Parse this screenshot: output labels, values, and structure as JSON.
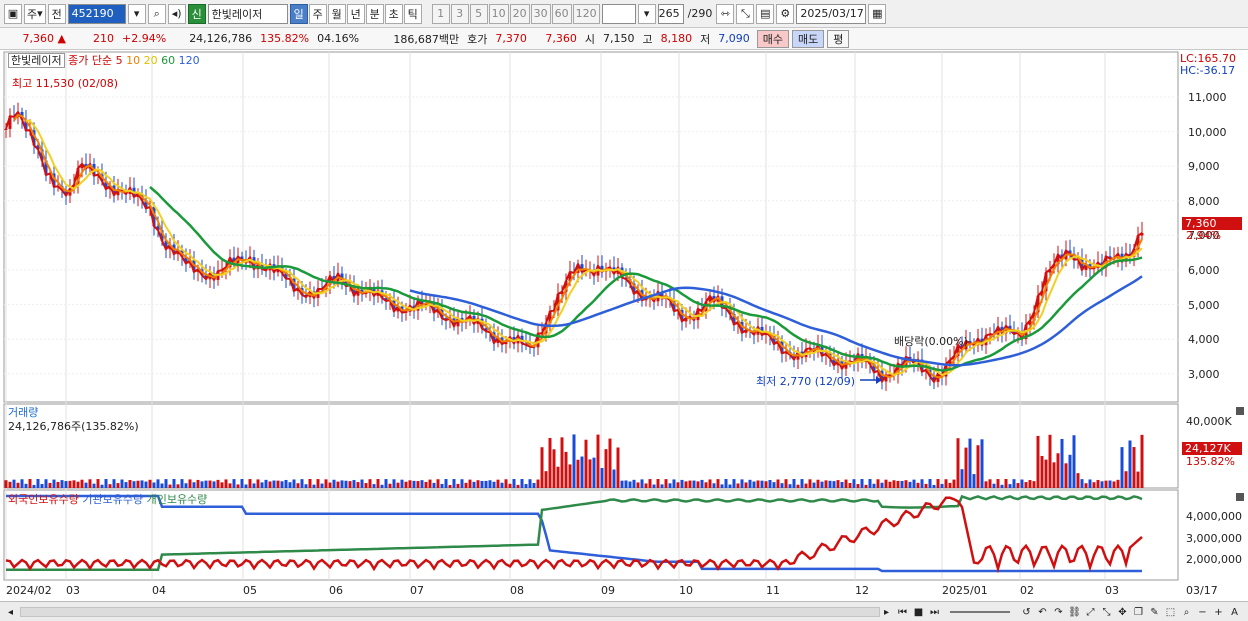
{
  "toolbar": {
    "market_type": "주",
    "market_prefix": "전",
    "stock_code": "452190",
    "new_badge": "신",
    "stock_name": "한빛레이저",
    "periods": [
      "일",
      "주",
      "월",
      "년",
      "분",
      "초",
      "틱"
    ],
    "active_period": "일",
    "interval_buttons": [
      "1",
      "3",
      "5",
      "10",
      "20",
      "30",
      "60",
      "120"
    ],
    "page_counter": "265",
    "page_total": "/290",
    "date": "2025/03/17"
  },
  "quote": {
    "price": "7,360 ▲",
    "change": "210",
    "change_pct": "+2.94%",
    "volume": "24,126,786",
    "volume_ratio": "135.82%",
    "turnover": "04.16%",
    "amount": "186,687백만",
    "bid_label": "호가",
    "bid1": "7,370",
    "bid2": "7,360",
    "open_label": "시",
    "open": "7,150",
    "high_label": "고",
    "high": "8,180",
    "low_label": "저",
    "low": "7,090",
    "buy_button": "매수",
    "sell_button": "매도",
    "eval_button": "평"
  },
  "price_panel": {
    "stock_name_label": "한빛레이저",
    "legend_title": "종가 단순",
    "ma_periods": [
      "5",
      "10",
      "20",
      "60",
      "120"
    ],
    "ma_colors": [
      "#d01010",
      "#f08000",
      "#f0d020",
      "#1a9a3a",
      "#2e5fd8"
    ],
    "high_note": "최고 11,530 (02/08)",
    "low_note": "최저 2,770 (12/09)",
    "dividend_note": "배당락(0.00%)",
    "lc_label": "LC:165.70",
    "hc_label": "HC:-36.17",
    "price_ticks": [
      "11,000",
      "10,000",
      "9,000",
      "8,000",
      "7,000",
      "6,000",
      "5,000",
      "4,000",
      "3,000"
    ],
    "current_price_tag": "7,360",
    "current_pct_tag": "2.94%"
  },
  "volume_panel": {
    "title": "거래량",
    "value_label": "24,126,786주(135.82%)",
    "tick": "40,000K",
    "current_tag": "24,127K",
    "current_pct": "135.82%"
  },
  "holding_panel": {
    "legend": [
      "외국인보유수량",
      "기관보유수량",
      "개인보유수량"
    ],
    "legend_colors": [
      "#d01010",
      "#2e5fd8",
      "#2f8a4a"
    ],
    "ticks": [
      "4,000,000",
      "3,000,000",
      "2,000,000"
    ]
  },
  "x_axis": {
    "labels": [
      "2024/02",
      "03",
      "04",
      "05",
      "06",
      "07",
      "08",
      "09",
      "10",
      "11",
      "12",
      "2025/01",
      "02",
      "03"
    ],
    "right_label": "03/17"
  },
  "chart_data": {
    "type": "candlestick",
    "title": "한빛레이저",
    "x_range": [
      "2024/02",
      "2025/03/17"
    ],
    "y_range": [
      2770,
      11530
    ],
    "close_series_approx": [
      {
        "month": "2024/02",
        "close": 10200
      },
      {
        "month": "2024/03",
        "close": 8700
      },
      {
        "month": "2024/04",
        "close": 7100
      },
      {
        "month": "2024/05",
        "close": 6200
      },
      {
        "month": "2024/06",
        "close": 5600
      },
      {
        "month": "2024/07",
        "close": 4800
      },
      {
        "month": "2024/08",
        "close": 4200
      },
      {
        "month": "2024/09",
        "close": 6000
      },
      {
        "month": "2024/10",
        "close": 5000
      },
      {
        "month": "2024/11",
        "close": 3700
      },
      {
        "month": "2024/12",
        "close": 3100
      },
      {
        "month": "2025/01",
        "close": 4100
      },
      {
        "month": "2025/02",
        "close": 6200
      },
      {
        "month": "2025/03",
        "close": 7360
      }
    ]
  }
}
